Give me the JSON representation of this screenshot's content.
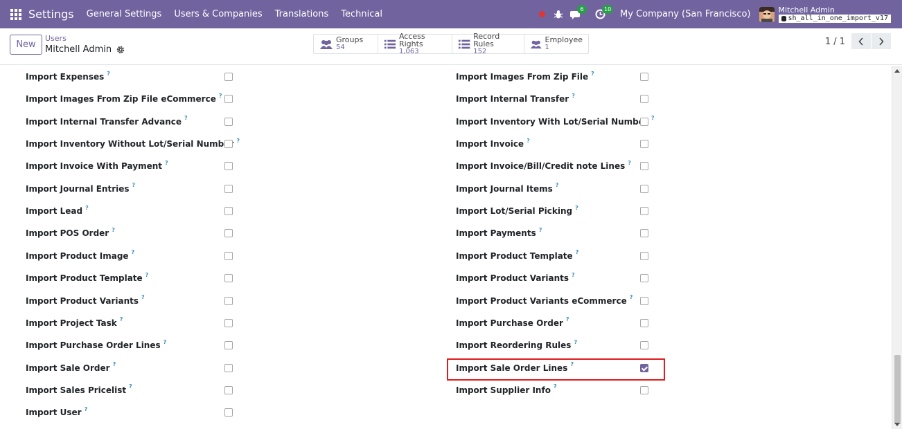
{
  "navbar": {
    "brand": "Settings",
    "menu": [
      "General Settings",
      "Users & Companies",
      "Translations",
      "Technical"
    ],
    "messages_count": "6",
    "activities_count": "10",
    "company": "My Company (San Francisco)",
    "user_name": "Mitchell Admin",
    "db_name": "sh_all_in_one_import_v17"
  },
  "control": {
    "new_label": "New",
    "breadcrumb_parent": "Users",
    "breadcrumb_current": "Mitchell Admin",
    "stats": [
      {
        "label": "Groups",
        "value": "54",
        "icon": "users-icon"
      },
      {
        "label": "Access Rights",
        "value": "1,063",
        "icon": "list-icon"
      },
      {
        "label": "Record Rules",
        "value": "152",
        "icon": "list-icon"
      },
      {
        "label": "Employee",
        "value": "1",
        "icon": "users-icon"
      }
    ],
    "pager": "1 / 1"
  },
  "left_column": [
    {
      "label": "Import Expenses",
      "checked": false
    },
    {
      "label": "Import Images From Zip File eCommerce",
      "checked": false
    },
    {
      "label": "Import Internal Transfer Advance",
      "checked": false
    },
    {
      "label": "Import Inventory Without Lot/Serial Number",
      "checked": false
    },
    {
      "label": "Import Invoice With Payment",
      "checked": false
    },
    {
      "label": "Import Journal Entries",
      "checked": false
    },
    {
      "label": "Import Lead",
      "checked": false
    },
    {
      "label": "Import POS Order",
      "checked": false
    },
    {
      "label": "Import Product Image",
      "checked": false
    },
    {
      "label": "Import Product Template",
      "checked": false
    },
    {
      "label": "Import Product Variants",
      "checked": false
    },
    {
      "label": "Import Project Task",
      "checked": false
    },
    {
      "label": "Import Purchase Order Lines",
      "checked": false
    },
    {
      "label": "Import Sale Order",
      "checked": false
    },
    {
      "label": "Import Sales Pricelist",
      "checked": false
    },
    {
      "label": "Import User",
      "checked": false
    }
  ],
  "right_column": [
    {
      "label": "Import Images From Zip File",
      "checked": false
    },
    {
      "label": "Import Internal Transfer",
      "checked": false
    },
    {
      "label": "Import Inventory With Lot/Serial Number",
      "checked": false
    },
    {
      "label": "Import Invoice",
      "checked": false
    },
    {
      "label": "Import Invoice/Bill/Credit note Lines",
      "checked": false
    },
    {
      "label": "Import Journal Items",
      "checked": false
    },
    {
      "label": "Import Lot/Serial Picking",
      "checked": false
    },
    {
      "label": "Import Payments",
      "checked": false
    },
    {
      "label": "Import Product Template",
      "checked": false
    },
    {
      "label": "Import Product Variants",
      "checked": false
    },
    {
      "label": "Import Product Variants eCommerce",
      "checked": false
    },
    {
      "label": "Import Purchase Order",
      "checked": false
    },
    {
      "label": "Import Reordering Rules",
      "checked": false
    },
    {
      "label": "Import Sale Order Lines",
      "checked": true
    },
    {
      "label": "Import Supplier Info",
      "checked": false
    }
  ],
  "tooltip_mark": "?",
  "colors": {
    "primary": "#71639e",
    "highlight": "#e01b1b",
    "badge": "#2a9d4a",
    "tooltip": "#3c8fb8"
  }
}
